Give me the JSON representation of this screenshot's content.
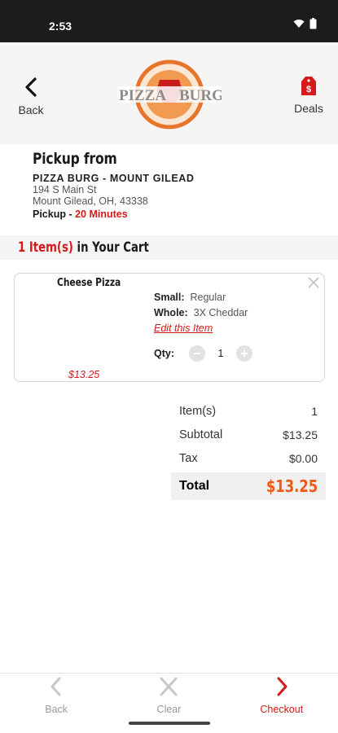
{
  "status_bar": {
    "time": "2:53"
  },
  "header": {
    "back_label": "Back",
    "deals_label": "Deals",
    "logo_text_left": "PIZZA",
    "logo_text_right": "BURG"
  },
  "pickup": {
    "title": "Pickup from",
    "store_name": "PIZZA BURG - MOUNT GILEAD",
    "address_line1": "194 S Main St",
    "address_line2": "Mount Gilead, OH, 43338",
    "pickup_label": "Pickup",
    "pickup_sep": " - ",
    "pickup_time": "20 Minutes"
  },
  "cart": {
    "count_text": "1 Item(s)",
    "suffix_text": " in Your Cart"
  },
  "items": [
    {
      "name": "Cheese Pizza",
      "options": [
        {
          "key": "Small:",
          "value": "Regular"
        },
        {
          "key": "Whole:",
          "value": "3X Cheddar"
        }
      ],
      "edit_label": "Edit this Item",
      "qty_label": "Qty:",
      "qty": "1",
      "price": "$13.25"
    }
  ],
  "summary": {
    "items_label": "Item(s)",
    "items_value": "1",
    "subtotal_label": "Subtotal",
    "subtotal_value": "$13.25",
    "tax_label": "Tax",
    "tax_value": "$0.00",
    "total_label": "Total",
    "total_value": "$13.25"
  },
  "bottom_nav": {
    "back": "Back",
    "clear": "Clear",
    "checkout": "Checkout"
  },
  "colors": {
    "accent_red": "#d61a1a",
    "total_orange": "#f05a14",
    "logo_orange": "#e8732a"
  }
}
